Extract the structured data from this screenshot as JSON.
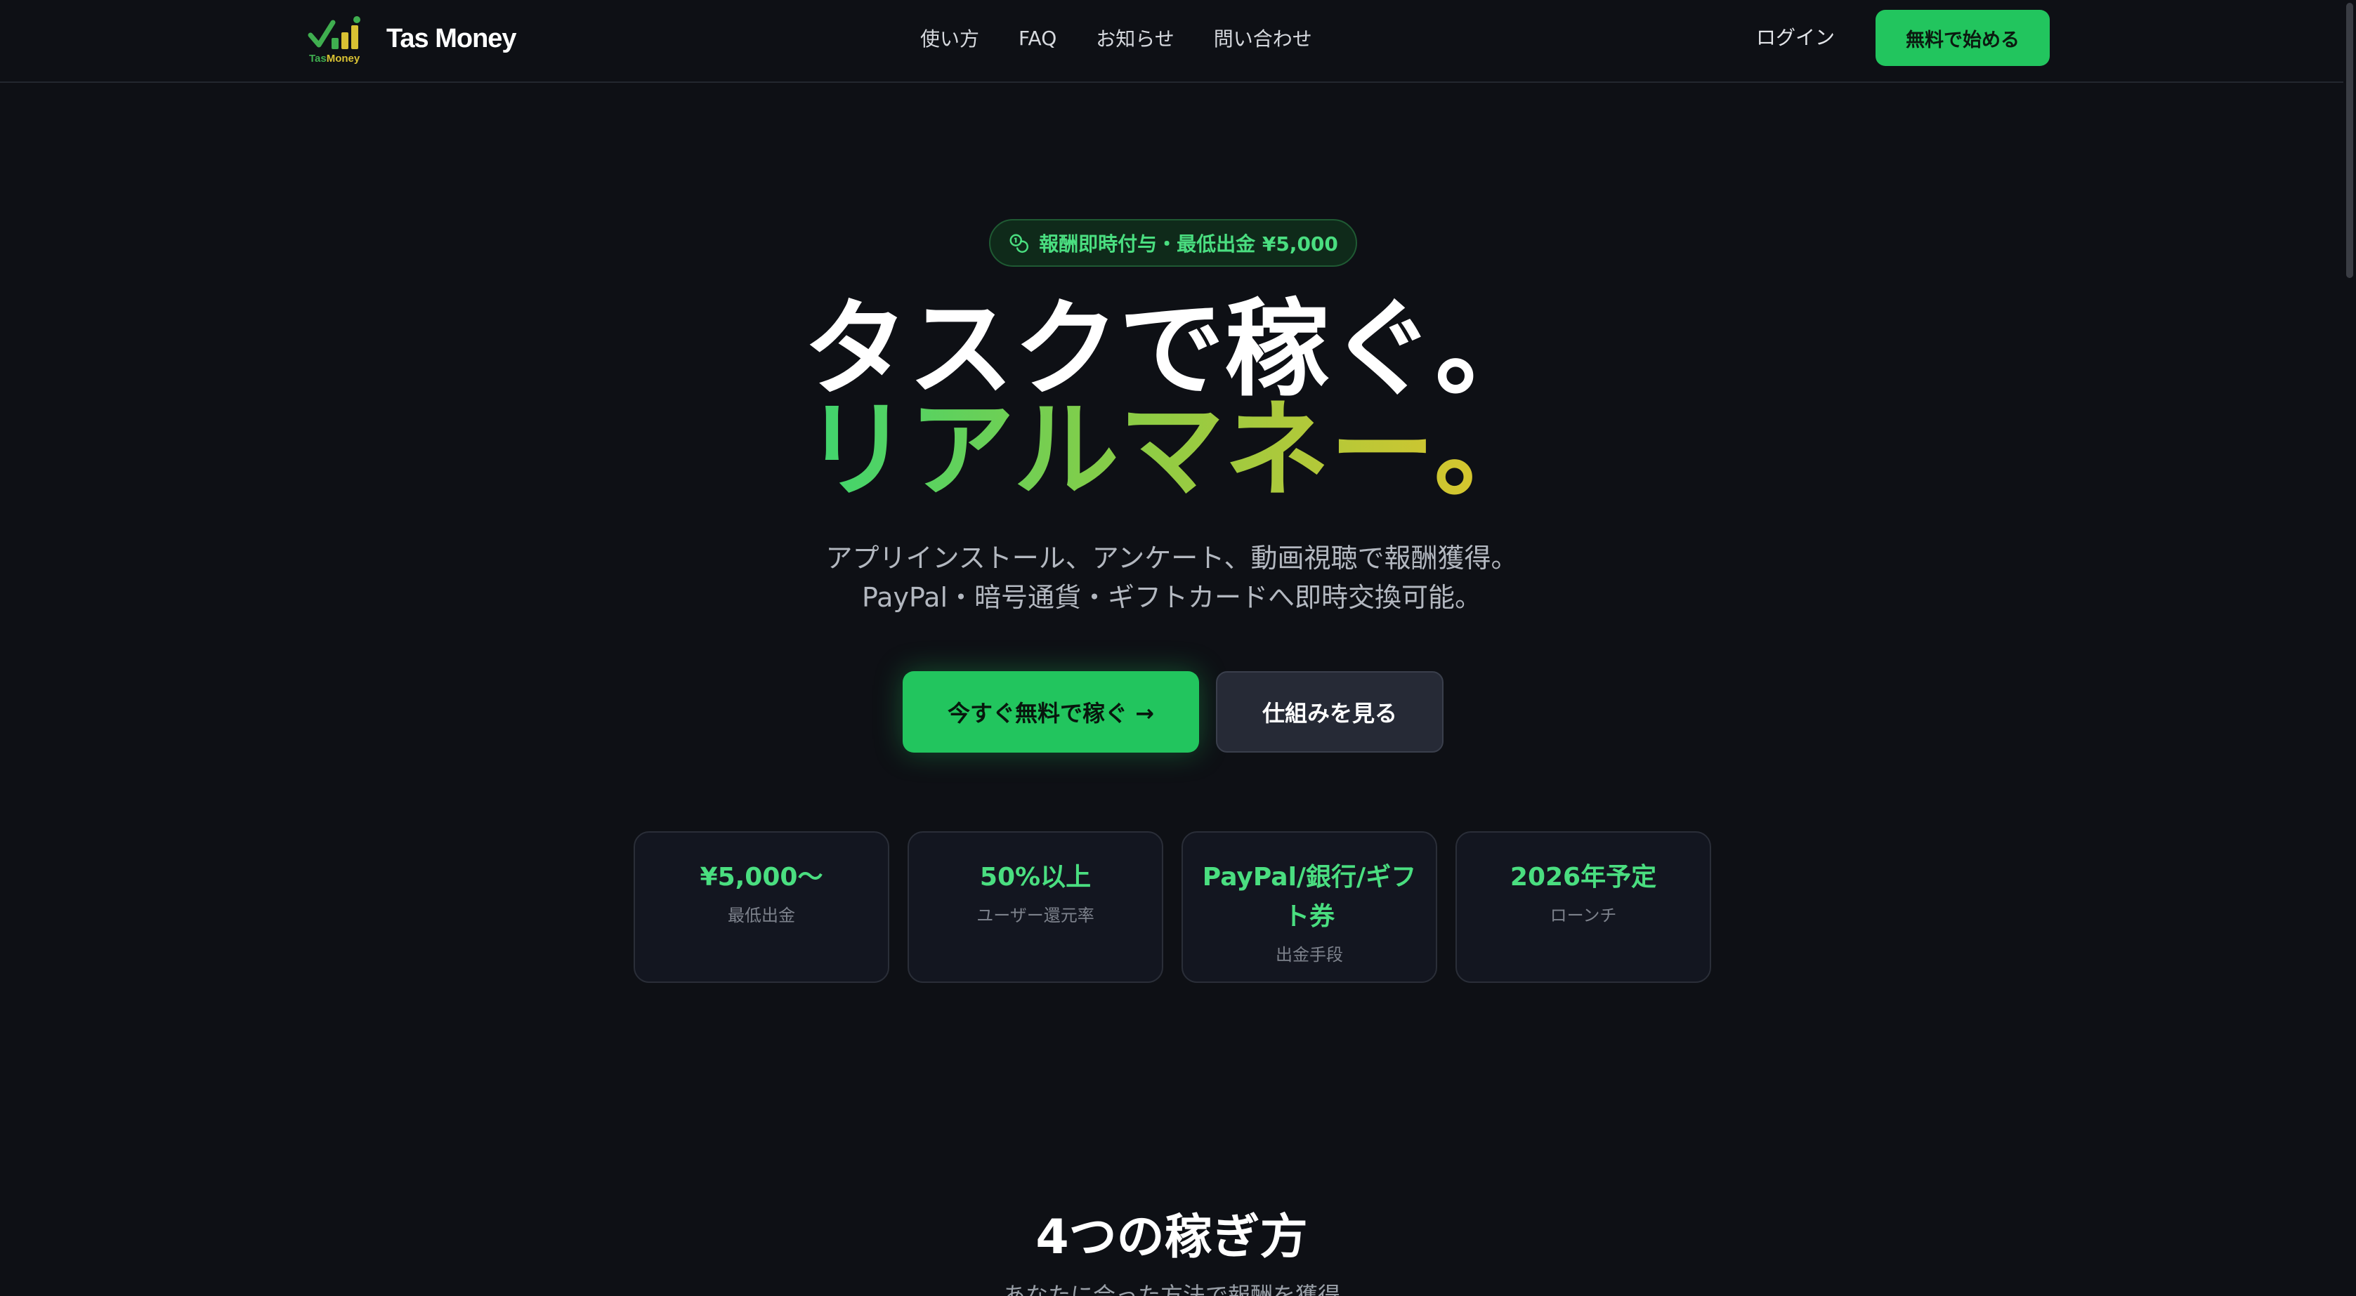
{
  "header": {
    "logo_small_text_1": "Tas",
    "logo_small_text_2": "Money",
    "brand": "Tas Money",
    "nav": [
      {
        "label": "使い方"
      },
      {
        "label": "FAQ"
      },
      {
        "label": "お知らせ"
      },
      {
        "label": "問い合わせ"
      }
    ],
    "login_label": "ログイン",
    "start_label": "無料で始める"
  },
  "hero": {
    "badge_text": "報酬即時付与・最低出金 ¥5,000",
    "headline_line1": "タスクで稼ぐ。",
    "headline_line2": "リアルマネー。",
    "subtitle_line1": "アプリインストール、アンケート、動画視聴で報酬獲得。",
    "subtitle_line2": "PayPal・暗号通貨・ギフトカードへ即時交換可能。",
    "primary_cta": "今すぐ無料で稼ぐ →",
    "secondary_cta": "仕組みを見る"
  },
  "stats": [
    {
      "value": "¥5,000〜",
      "label": "最低出金"
    },
    {
      "value": "50%以上",
      "label": "ユーザー還元率"
    },
    {
      "value": "PayPal/銀行/ギフト券",
      "label": "出金手段"
    },
    {
      "value": "2026年予定",
      "label": "ローンチ"
    }
  ],
  "section": {
    "title": "4つの稼ぎ方",
    "subtitle": "あなたに合った方法で報酬を獲得"
  },
  "colors": {
    "background": "#0e1015",
    "accent": "#22c55e",
    "accent_text": "#4ade80",
    "gradient_end": "#e3c42a"
  }
}
